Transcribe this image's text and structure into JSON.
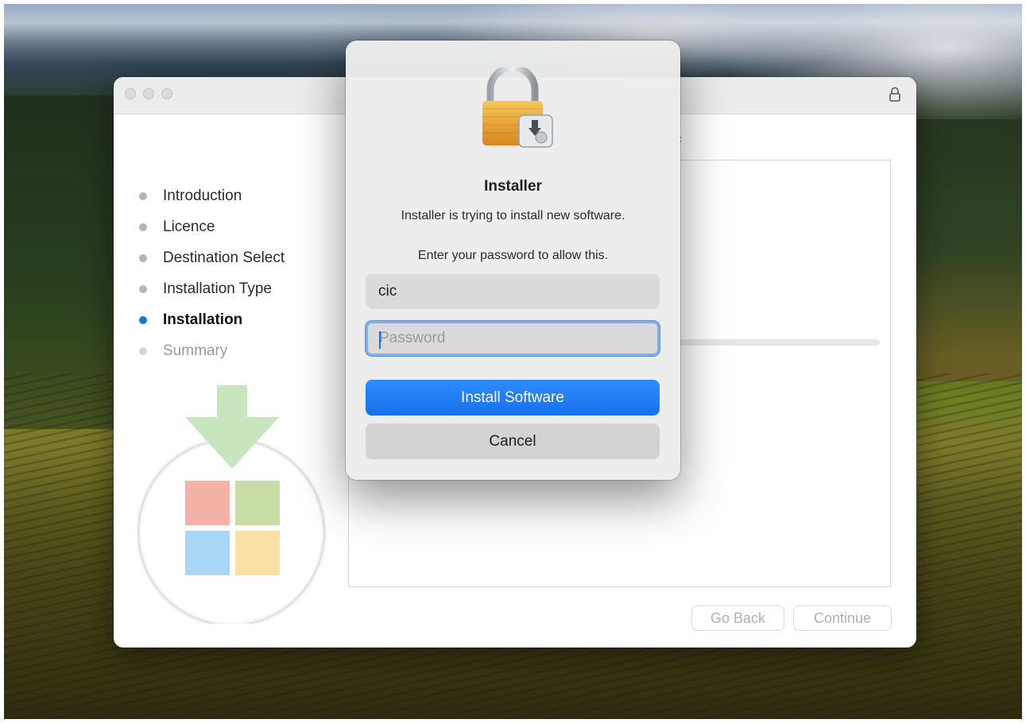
{
  "window": {
    "title": "c",
    "subtitle": "c"
  },
  "steps": [
    {
      "label": "Introduction",
      "state": "done"
    },
    {
      "label": "Licence",
      "state": "done"
    },
    {
      "label": "Destination Select",
      "state": "done"
    },
    {
      "label": "Installation Type",
      "state": "done"
    },
    {
      "label": "Installation",
      "state": "active"
    },
    {
      "label": "Summary",
      "state": "future"
    }
  ],
  "footer": {
    "go_back_label": "Go Back",
    "continue_label": "Continue"
  },
  "auth": {
    "title": "Installer",
    "message": "Installer is trying to install new software.",
    "prompt": "Enter your password to allow this.",
    "username_value": "cic",
    "password_placeholder": "Password",
    "install_label": "Install Software",
    "cancel_label": "Cancel"
  },
  "colors": {
    "accent": "#1a73e8",
    "primary_button": "#1670ec",
    "focus_ring": "#7eaef0",
    "step_inactive_dot": "#b5b5b5"
  },
  "icons": {
    "titlebar_lock": "lock-icon",
    "dialog_icon": "padlock-installer-icon",
    "package_illustration": "package-download-icon"
  }
}
